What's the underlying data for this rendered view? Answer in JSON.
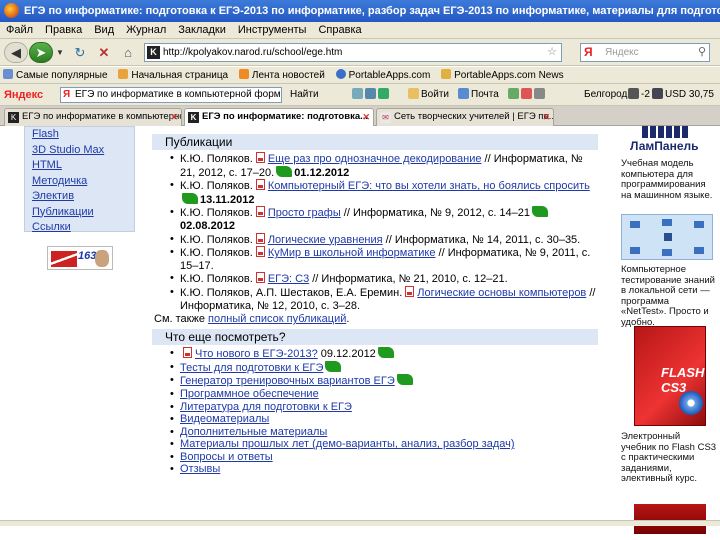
{
  "window": {
    "title": "ЕГЭ по информатике: подготовка к ЕГЭ-2013 по информатике, разбор задач ЕГЭ-2013 по информатике, материалы для подготовки к ЕГЭ - Mo..."
  },
  "menu": [
    "Файл",
    "Правка",
    "Вид",
    "Журнал",
    "Закладки",
    "Инструменты",
    "Справка"
  ],
  "nav": {
    "url": "http://kpolyakov.narod.ru/school/ege.htm",
    "search_placeholder": "Яндекс",
    "search_logo": "Я"
  },
  "bookmarks": [
    "Самые популярные",
    "Начальная страница",
    "Лента новостей",
    "PortableApps.com",
    "PortableApps.com News"
  ],
  "yandex_bar": {
    "logo": "Яндекс",
    "query": "ЕГЭ по информатике в компьютерной форме",
    "find_label": "Найти",
    "login_label": "Войти",
    "mail_label": "Почта",
    "city": "Белгород",
    "temperature": "-2",
    "currency": "USD 30,75"
  },
  "tabs": [
    {
      "label": "ЕГЭ по информатике в компьютерно...",
      "active": false
    },
    {
      "label": "ЕГЭ по информатике: подготовка...",
      "active": true
    },
    {
      "label": "Сеть творческих учителей | ЕГЭ по...",
      "active": false
    }
  ],
  "sidebar": {
    "items": [
      "Flash",
      "3D Studio Max",
      "HTML",
      "Методичка",
      "Электив",
      "Публикации",
      "Ссылки"
    ],
    "badge": "163"
  },
  "publications": {
    "heading": "Публикации",
    "items": [
      {
        "before": "К.Ю. Поляков.",
        "link": "Еще раз про однозначное декодирование",
        "after": " // Информатика, № 21, 2012, с. 17–20.",
        "date": "01.12.2012"
      },
      {
        "before": "К.Ю. Поляков.",
        "link": "Компьютерный ЕГЭ: что вы хотели знать, но боялись спросить",
        "after": "",
        "date": "13.11.2012"
      },
      {
        "before": "К.Ю. Поляков.",
        "link": "Просто графы",
        "after": " // Информатика, № 9, 2012, с. 14–21",
        "date": "02.08.2012"
      },
      {
        "before": "К.Ю. Поляков.",
        "link": "Логические уравнения",
        "after": " // Информатика, № 14, 2011, с. 30–35.",
        "date": ""
      },
      {
        "before": "К.Ю. Поляков.",
        "link": "КуМир в школьной информатике",
        "after": " // Информатика, № 9, 2011, с. 15–17.",
        "date": ""
      },
      {
        "before": "К.Ю. Поляков.",
        "link": "ЕГЭ: С3",
        "after": " // Информатика, № 21, 2010, с. 12–21.",
        "date": ""
      },
      {
        "before": "К.Ю. Поляков, А.П. Шестаков, Е.А. Еремин.",
        "link": "Логические основы компьютеров",
        "after": " // Информатика, № 12, 2010, с. 3–28.",
        "date": ""
      }
    ],
    "see_also_prefix": "См. также ",
    "see_also_link": "полный список публикаций",
    "see_also_suffix": "."
  },
  "more": {
    "heading": "Что еще посмотреть?",
    "items": [
      {
        "link": "Что нового в ЕГЭ-2013?",
        "date": "09.12.2012",
        "pdf": true,
        "flag": true
      },
      {
        "link": "Тесты для подготовки к ЕГЭ",
        "date": "",
        "pdf": false,
        "flag": true
      },
      {
        "link": "Генератор тренировочных вариантов ЕГЭ",
        "date": "",
        "pdf": false,
        "flag": true
      },
      {
        "link": "Программное обеспечение",
        "date": "",
        "pdf": false,
        "flag": false
      },
      {
        "link": "Литература для подготовки к ЕГЭ",
        "date": "",
        "pdf": false,
        "flag": false
      },
      {
        "link": "Видеоматериалы",
        "date": "",
        "pdf": false,
        "flag": false
      },
      {
        "link": "Дополнительные материалы",
        "date": "",
        "pdf": false,
        "flag": false
      },
      {
        "link": "Материалы прошлых лет (демо-варианты, анализ, разбор задач)",
        "date": "",
        "pdf": false,
        "flag": false
      },
      {
        "link": "Вопросы и ответы",
        "date": "",
        "pdf": false,
        "flag": false
      },
      {
        "link": "Отзывы",
        "date": "",
        "pdf": false,
        "flag": false
      }
    ]
  },
  "ads": {
    "lam_logo": "ЛамПанель",
    "lam_text": "Учебная модель компьютера для программирования на машинном языке.",
    "net_text": "Компьютерное тестирование знаний в локальной сети — программа «NetTest». Просто и удобно.",
    "flash_cover": "FLASH CS3",
    "flash_text": "Электронный учебник по Flash CS3 с практическими заданиями, элективный курс."
  },
  "colors": {
    "link": "#1f3aa8",
    "section_bg": "#dde6f4",
    "titlebar": "#2458c4"
  }
}
